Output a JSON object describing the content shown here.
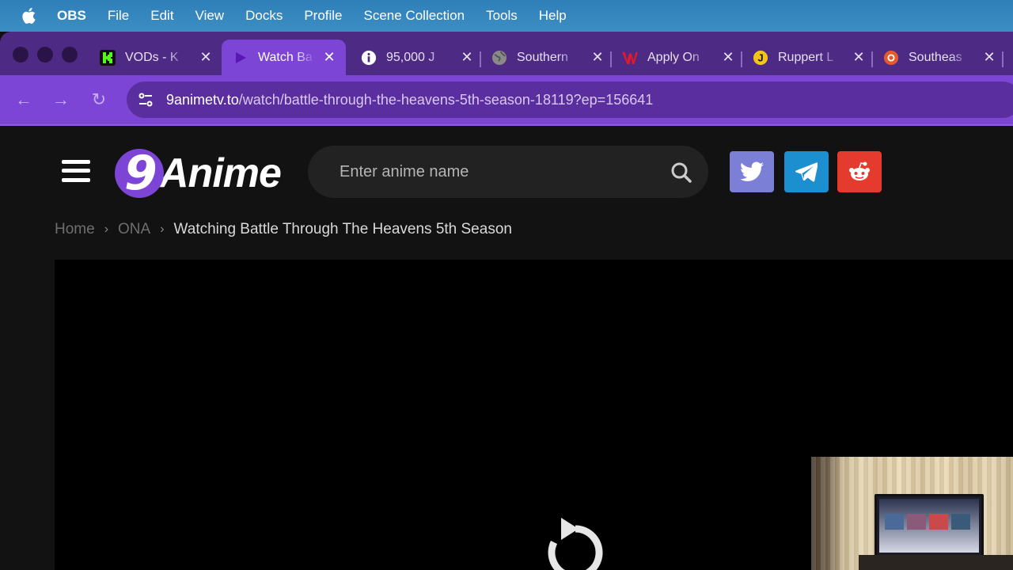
{
  "menubar": {
    "app_name": "OBS",
    "items": [
      "File",
      "Edit",
      "View",
      "Docks",
      "Profile",
      "Scene Collection",
      "Tools",
      "Help"
    ]
  },
  "tabs": [
    {
      "title": "VODs - K",
      "favicon": "kick-icon",
      "active": false
    },
    {
      "title": "Watch Ba",
      "favicon": "play-icon",
      "active": true
    },
    {
      "title": "95,000 J",
      "favicon": "info-icon",
      "active": false
    },
    {
      "title": "Southern",
      "favicon": "globe-icon",
      "active": false
    },
    {
      "title": "Apply On",
      "favicon": "w-icon",
      "active": false
    },
    {
      "title": "Ruppert L",
      "favicon": "j-icon",
      "active": false
    },
    {
      "title": "Southeas",
      "favicon": "lifebuoy-icon",
      "active": false
    }
  ],
  "address_bar": {
    "host": "9animetv.to",
    "path": "/watch/battle-through-the-heavens-5th-season-18119?ep=156641"
  },
  "site": {
    "logo_number": "9",
    "logo_word": "Anime",
    "search_placeholder": "Enter anime name",
    "social": [
      "twitter-icon",
      "telegram-icon",
      "reddit-icon"
    ]
  },
  "breadcrumb": {
    "home": "Home",
    "category": "ONA",
    "current": "Watching Battle Through The Heavens 5th Season"
  },
  "colors": {
    "accent": "#7d45d6",
    "twitter": "#7b7fd6",
    "telegram": "#1c8fd1",
    "reddit": "#e53b2f"
  }
}
